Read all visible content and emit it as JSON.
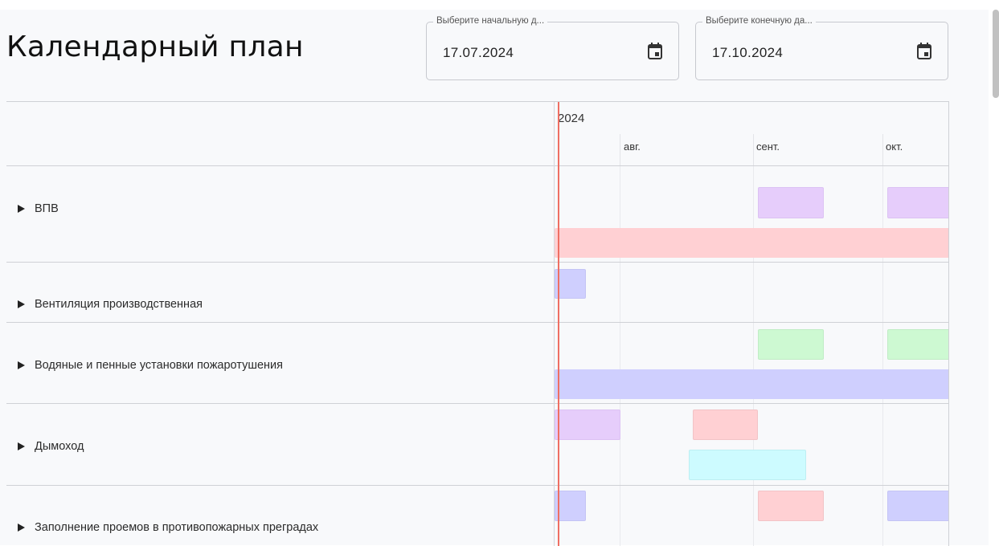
{
  "page": {
    "title": "Календарный план"
  },
  "date_range": {
    "start": {
      "label": "Выберите начальную д...",
      "value": "17.07.2024",
      "icon": "calendar-icon"
    },
    "end": {
      "label": "Выберите конечную да...",
      "value": "17.10.2024",
      "icon": "calendar-icon"
    }
  },
  "timeline": {
    "year": "2024",
    "months": [
      "авг.",
      "сент.",
      "окт."
    ]
  },
  "colors": {
    "purple": "#e6cdfb",
    "pink": "#ffd0d3",
    "blue": "#cfcffe",
    "green": "#cdf9d2",
    "cyan": "#cdfbff",
    "today_line": "#ef6f63"
  },
  "rows": [
    {
      "label": "ВПВ",
      "expand_icon": "triangle-right-icon"
    },
    {
      "label": "Вентиляция производственная",
      "expand_icon": "triangle-right-icon"
    },
    {
      "label": "Водяные и пенные установки пожаротушения",
      "expand_icon": "triangle-right-icon"
    },
    {
      "label": "Дымоход",
      "expand_icon": "triangle-right-icon"
    },
    {
      "label": "Заполнение проемов в противопожарных преградах",
      "expand_icon": "triangle-right-icon"
    }
  ]
}
